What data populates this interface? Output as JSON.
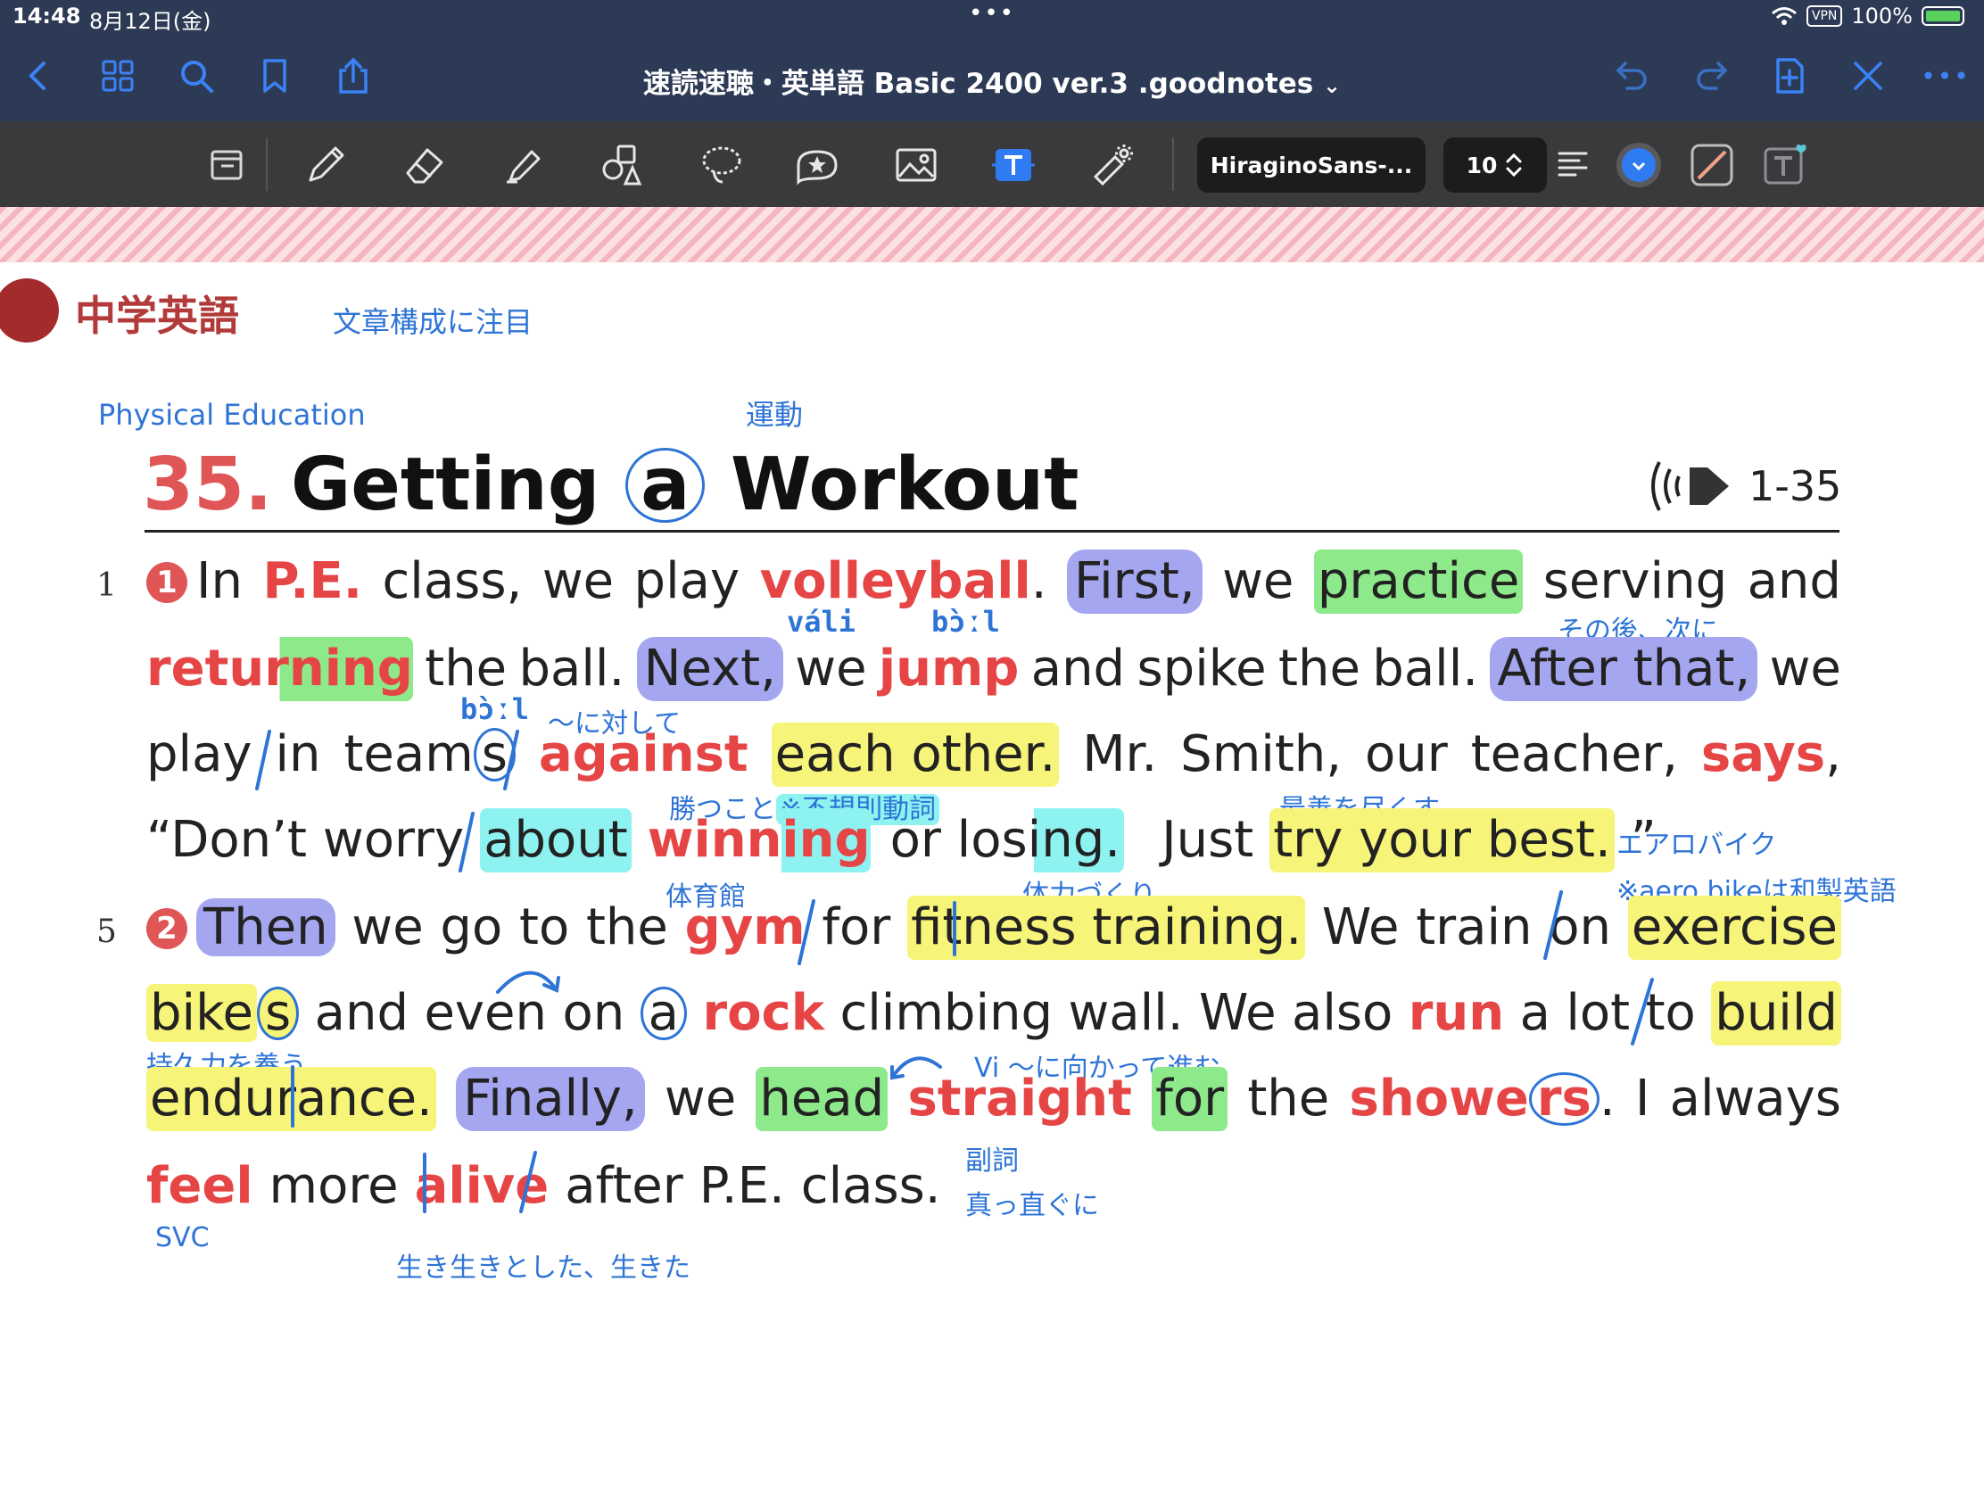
{
  "status_bar": {
    "time": "14:48",
    "date": "8月12日(金)",
    "dots": "•••",
    "vpn": "VPN",
    "battery": "100%"
  },
  "nav": {
    "title": "速読速聴・英単語 Basic 2400 ver.3 .goodnotes",
    "title_chevron": "⌄",
    "more": "•••"
  },
  "toolbar": {
    "font_name": "HiraginoSans-...",
    "font_size": "10",
    "font_size_stepper": "⌃⌄",
    "accent_color": "#2f7bf2"
  },
  "page": {
    "section": "中学英語",
    "notes": {
      "structure": "文章構成に注目",
      "pe": "Physical Education",
      "workout": "運動",
      "vali": "váli",
      "bo1": "bɔ̀ːl",
      "bo2": "bɔ̀ːl",
      "after": "その後、次に",
      "against": "〜に対して",
      "win": "勝つこと",
      "irregular": "※不規則動詞",
      "best": "最善を尽くす",
      "aero1": "エアロバイク",
      "aero2": "※aero bikeは和製英語",
      "gym": "体育館",
      "fitness": "体力づくり",
      "endurance": "持久力を養う",
      "vi": "Vi 〜に向かって進む",
      "adverb": "副詞",
      "straight": "真っ直ぐに",
      "svc": "SVC",
      "alive": "生き生きとした、生きた"
    },
    "lesson": {
      "number": "35.",
      "title_a": "Getting",
      "title_b": "a",
      "title_c": "Workout",
      "track": "1-35"
    },
    "line_numbers": {
      "l1": "1",
      "l5": "5"
    },
    "para_nums": {
      "p1": "1",
      "p2": "2"
    },
    "text": {
      "l1": {
        "a": "In",
        "b": "P.E.",
        "c": "class,",
        "d": "we",
        "e": "play",
        "f": "volleyball",
        "g": ".",
        "h": "First,",
        "i": "we",
        "j": "practice",
        "k": "serving",
        "l": "and"
      },
      "l2": {
        "a": "returning",
        "b": "the",
        "c": "ball.",
        "d": "Next,",
        "e": "we",
        "f": "jump",
        "g": "and",
        "h": "spike",
        "i": "the",
        "j": "ball.",
        "k": "After that,",
        "l": "we"
      },
      "l3": {
        "a": "play",
        "b": "in",
        "c": "team",
        "c2": "s",
        "d": "against",
        "e": "each other.",
        "f": "Mr.",
        "g": "Smith,",
        "h": "our",
        "i": "teacher,",
        "j": "says",
        "k": ","
      },
      "l4": {
        "a": "“Don’t",
        "b": "worry",
        "c": "about",
        "d": "winning",
        "e": "or losing.",
        "f": "Just",
        "g": "try your best.",
        "h": "”"
      },
      "l5": {
        "a": "Then",
        "b": "we",
        "c": "go",
        "d": "to",
        "e": "the",
        "f": "gym",
        "g": "for",
        "h": "fitness training.",
        "i": "We",
        "j": "train",
        "k": "on",
        "l": "exercise"
      },
      "l6": {
        "a": "bike",
        "a2": "s",
        "b": "and",
        "c": "even",
        "d": "on",
        "e": "a",
        "f": "rock",
        "g": "climbing",
        "h": "wall.",
        "i": "We",
        "j": "also",
        "k": "run",
        "l": "a",
        "m": "lot",
        "n": "to",
        "o": "build"
      },
      "l7": {
        "a": "endurance.",
        "b": "Finally,",
        "c": "we",
        "d": "head",
        "e": "straight",
        "f": "for",
        "g": "the",
        "h": "showe",
        "h2": "rs",
        "i": ".",
        "j": "I",
        "k": "always"
      },
      "l8": {
        "a": "feel",
        "b": "more",
        "c": "alive",
        "d": "after",
        "e": "P.E.",
        "f": "class."
      }
    }
  }
}
